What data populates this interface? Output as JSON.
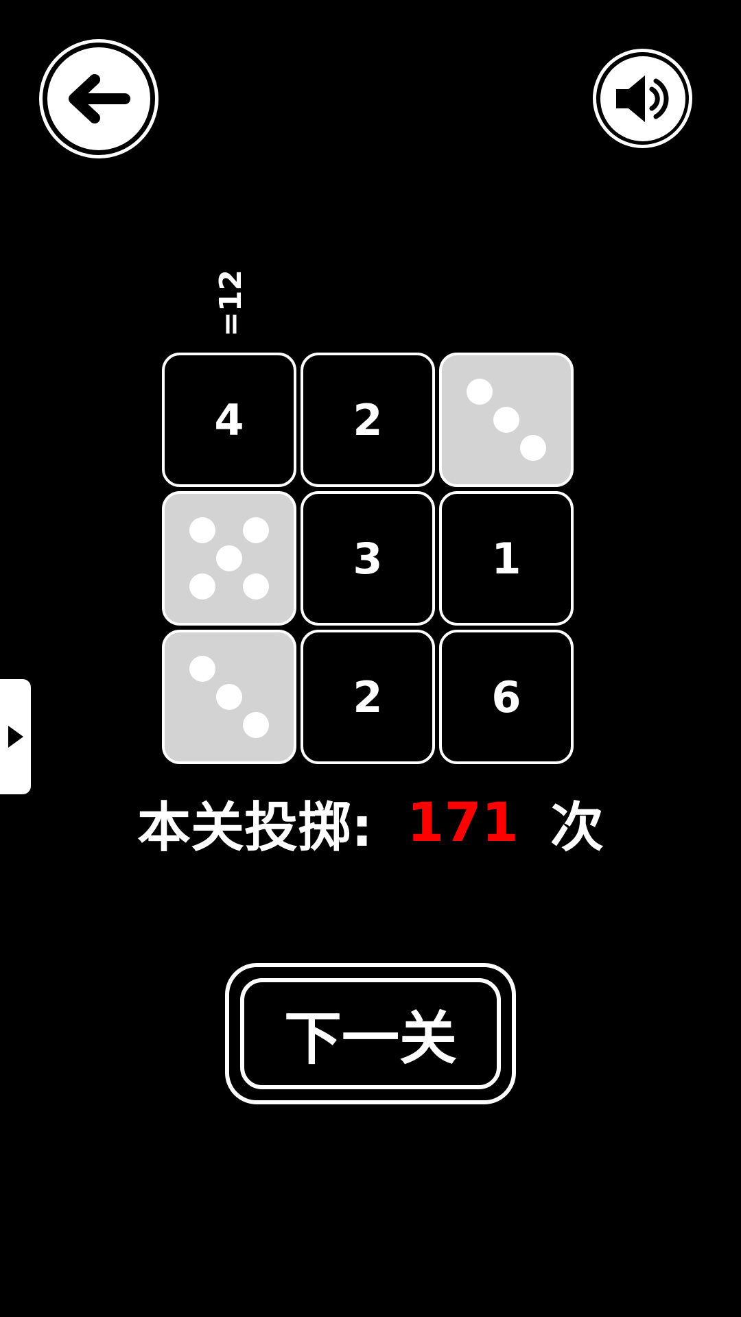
{
  "header": {
    "back_icon": "arrow-left-icon",
    "sound_icon": "speaker-icon"
  },
  "side_tab": {
    "icon": "play-triangle-icon"
  },
  "board": {
    "column_sum_label": "=12",
    "cells": [
      {
        "type": "number",
        "value": "4"
      },
      {
        "type": "number",
        "value": "2"
      },
      {
        "type": "die",
        "pips": 3
      },
      {
        "type": "die",
        "pips": 5
      },
      {
        "type": "number",
        "value": "3"
      },
      {
        "type": "number",
        "value": "1"
      },
      {
        "type": "die",
        "pips": 3
      },
      {
        "type": "number",
        "value": "2"
      },
      {
        "type": "number",
        "value": "6"
      }
    ]
  },
  "status": {
    "throws_label": "本关投掷:",
    "throws_count": "171",
    "throws_unit": "次"
  },
  "next_button": {
    "label": "下一关"
  },
  "colors": {
    "background": "#000000",
    "foreground": "#ffffff",
    "die_face": "#d3d3d3",
    "count_highlight": "#ff0000"
  }
}
